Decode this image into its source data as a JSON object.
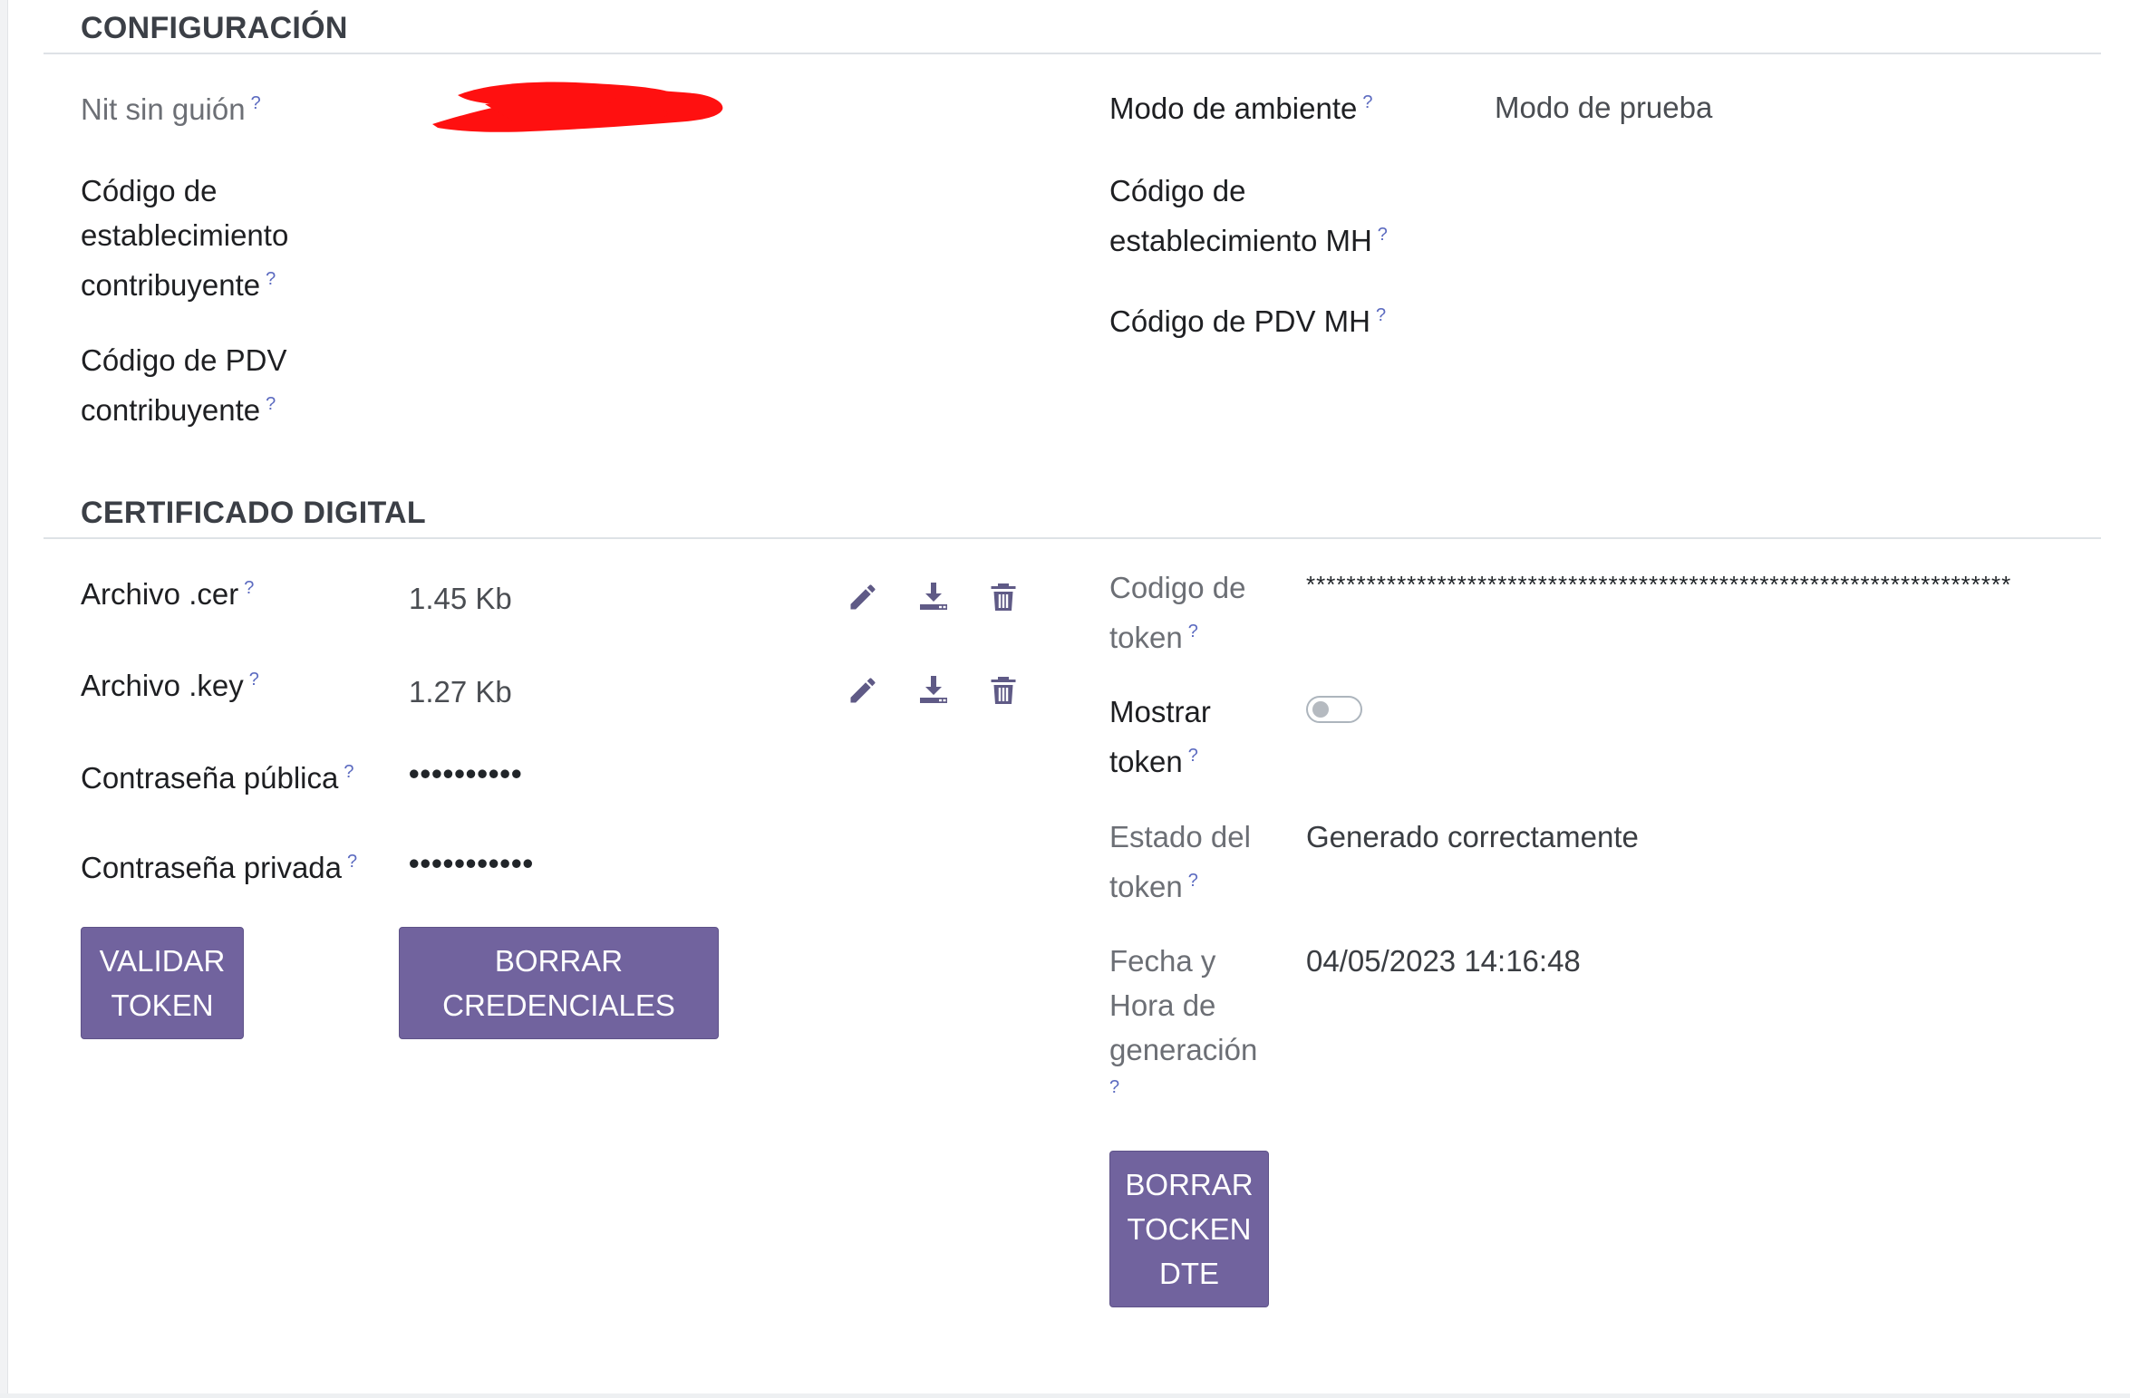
{
  "sections": {
    "config_title": "CONFIGURACIÓN",
    "cert_title": "CERTIFICADO DIGITAL"
  },
  "config": {
    "nit_label": "Nit sin guión",
    "cod_est_contrib_label_l1": "Código de",
    "cod_est_contrib_label_l2": "establecimiento",
    "cod_est_contrib_label_l3": "contribuyente",
    "cod_pdv_contrib_label_l1": "Código de PDV",
    "cod_pdv_contrib_label_l2": "contribuyente",
    "modo_ambiente_label": "Modo de ambiente",
    "modo_ambiente_value": "Modo de prueba",
    "cod_est_mh_label_l1": "Código de",
    "cod_est_mh_label_l2": "establecimiento MH",
    "cod_pdv_mh_label": "Código de PDV MH"
  },
  "cert": {
    "archivo_cer_label": "Archivo .cer",
    "archivo_cer_value": "1.45 Kb",
    "archivo_key_label": "Archivo .key",
    "archivo_key_value": "1.27 Kb",
    "pass_publica_label": "Contraseña pública",
    "pass_publica_value": "••••••••••",
    "pass_privada_label": "Contraseña privada",
    "pass_privada_value": "•••••••••••",
    "validar_btn_l1": "VALIDAR",
    "validar_btn_l2": "TOKEN",
    "borrar_cred_btn_l1": "BORRAR",
    "borrar_cred_btn_l2": "CREDENCIALES",
    "codigo_token_label_l1": "Codigo de",
    "codigo_token_label_l2": "token",
    "codigo_token_value": "**********************************************************************",
    "mostrar_token_label_l1": "Mostrar",
    "mostrar_token_label_l2": "token",
    "mostrar_token_on": false,
    "estado_token_label_l1": "Estado del",
    "estado_token_label_l2": "token",
    "estado_token_value": "Generado correctamente",
    "fecha_label_l1": "Fecha y",
    "fecha_label_l2": "Hora de",
    "fecha_label_l3": "generación",
    "fecha_value": "04/05/2023 14:16:48",
    "borrar_tocken_btn_l1": "BORRAR",
    "borrar_tocken_btn_l2": "TOCKEN",
    "borrar_tocken_btn_l3": "DTE"
  },
  "help_mark": "?",
  "icons": [
    "pencil-icon",
    "download-icon",
    "trash-icon"
  ],
  "colors": {
    "accent": "#71639e",
    "help": "#5c6bc0",
    "redaction": "#ff0000"
  }
}
